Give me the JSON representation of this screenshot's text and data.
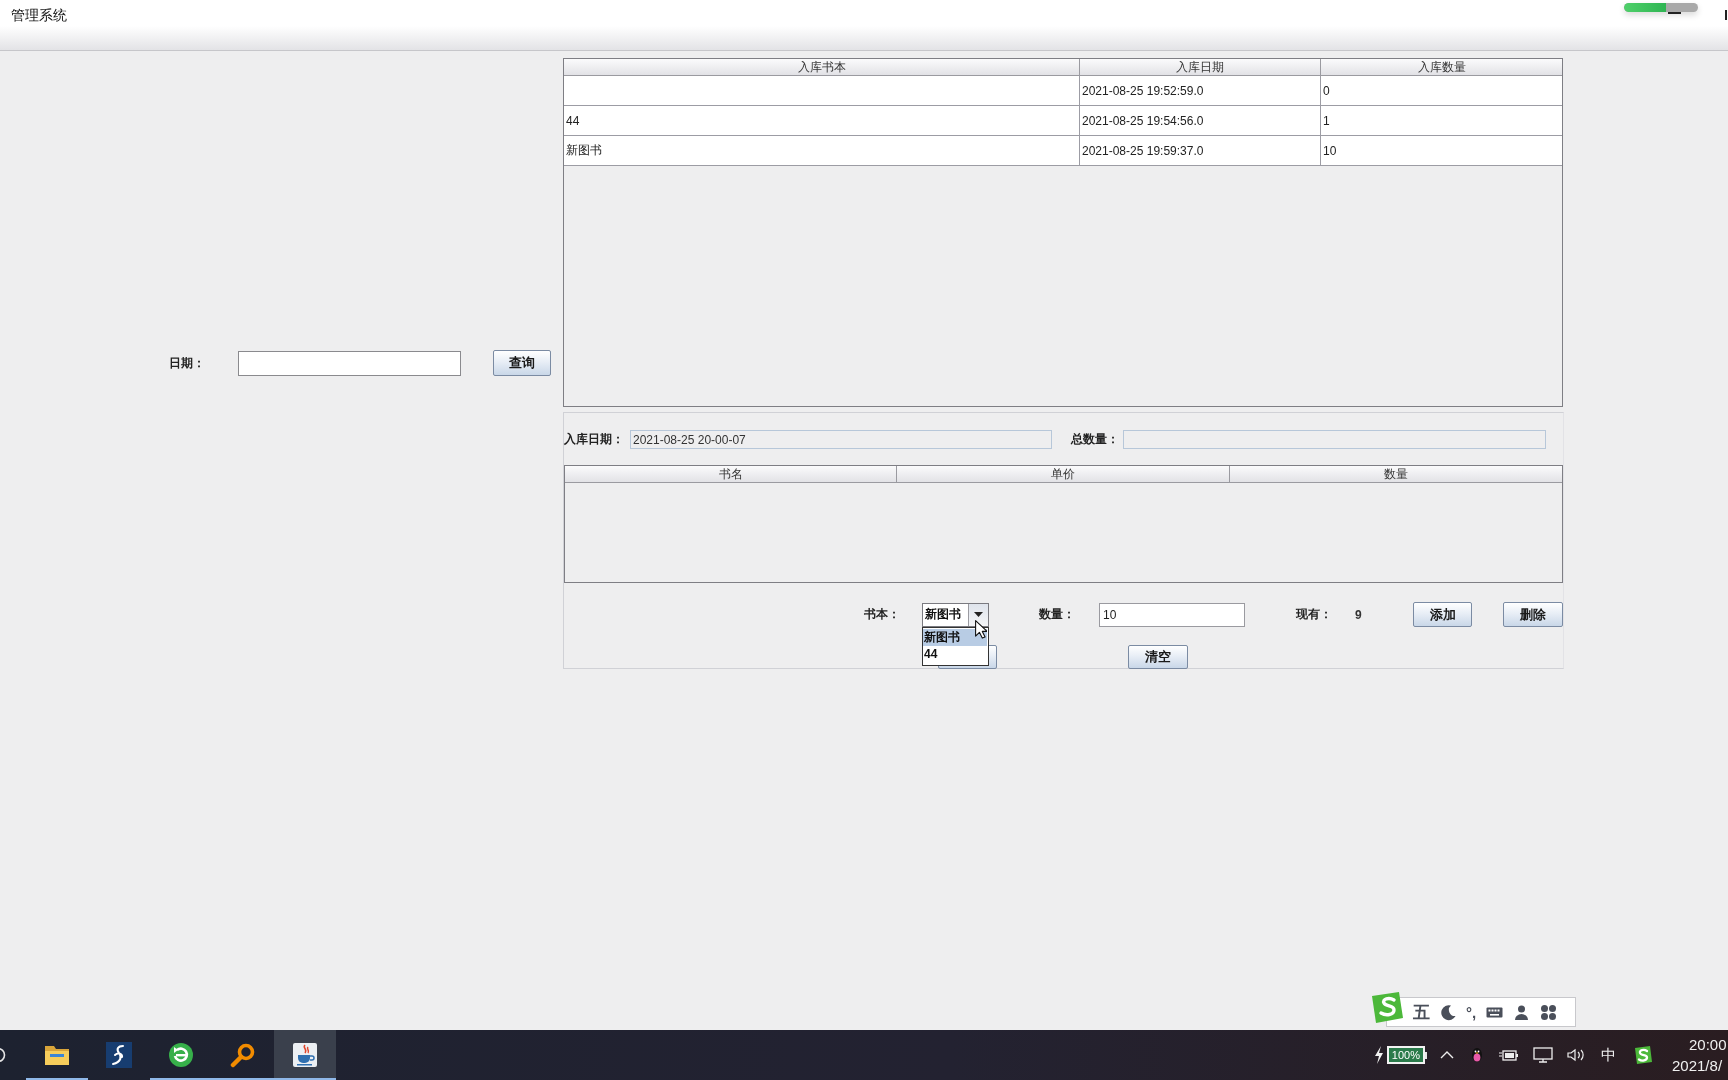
{
  "window": {
    "title": "管理系统"
  },
  "title_bar": {
    "progress_pill": {
      "level": 0.57
    }
  },
  "query": {
    "label": "日期：",
    "button": "查询"
  },
  "records_table": {
    "columns": [
      "入库书本",
      "入库日期",
      "入库数量"
    ],
    "rows": [
      [
        null,
        "2021-08-25 19:52:59.0",
        "0"
      ],
      [
        "44",
        "2021-08-25 19:54:56.0",
        "1"
      ],
      [
        "新图书",
        "2021-08-25 19:59:37.0",
        "10"
      ]
    ]
  },
  "entry_form": {
    "date_label": "入库日期：",
    "date_value": "2021-08-25 20-00-07",
    "total_label": "总数量："
  },
  "items_table": {
    "columns": [
      "书名",
      "单价",
      "数量"
    ]
  },
  "book_picker": {
    "label": "书本：",
    "value": "新图书",
    "expanded": true,
    "options": [
      {
        "label": "新图书",
        "selected": true
      },
      {
        "label": "44",
        "selected": false
      }
    ]
  },
  "quantity": {
    "label": "数量：",
    "value": "10"
  },
  "stock": {
    "label": "现有：",
    "value": "9"
  },
  "buttons": [
    {
      "label": "添加"
    },
    {
      "label": "删除"
    }
  ],
  "clear_button": {
    "label": "清空"
  },
  "ime_toolbar": {
    "mode": "五",
    "punctuation": "°,"
  },
  "taskbar": {
    "apps": [
      {
        "kind": "folder",
        "selected": false,
        "running": true
      },
      {
        "kind": "script",
        "selected": false,
        "running": false
      },
      {
        "kind": "globe",
        "selected": false,
        "running": true
      },
      {
        "kind": "magnifier",
        "selected": false,
        "running": true
      },
      {
        "kind": "java",
        "selected": true,
        "running": true
      }
    ],
    "tray": {
      "battery": "100%",
      "input_method": "中",
      "time": "20:00",
      "date": "2021/8/"
    }
  }
}
